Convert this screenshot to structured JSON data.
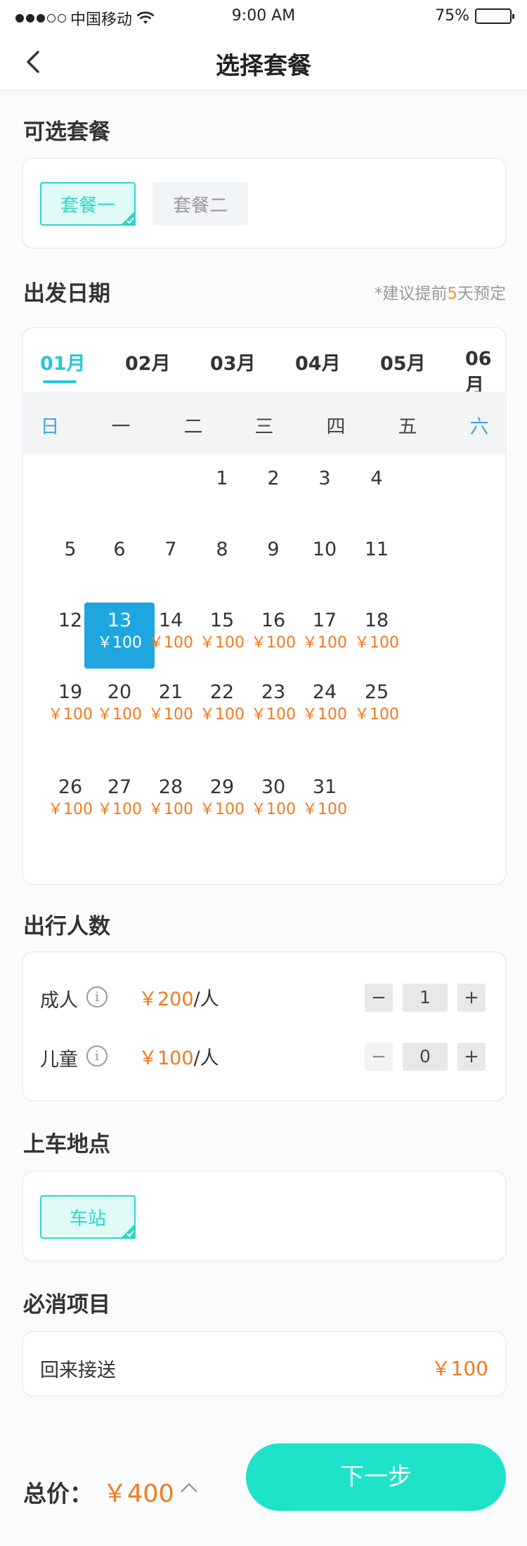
{
  "status_bar": {
    "carrier": "中国移动",
    "time": "9:00 AM",
    "battery": "75%",
    "battery_level": 0.75
  },
  "nav": {
    "title": "选择套餐"
  },
  "packages": {
    "title": "可选套餐",
    "items": [
      {
        "label": "套餐一",
        "selected": true
      },
      {
        "label": "套餐二",
        "selected": false
      }
    ]
  },
  "date": {
    "title": "出发日期",
    "hint_prefix": "*建议提前",
    "hint_days": "5",
    "hint_suffix": "天预定",
    "months": [
      "01月",
      "02月",
      "03月",
      "04月",
      "05月",
      "06月"
    ],
    "active_month": 0,
    "weekdays": [
      "日",
      "一",
      "二",
      "三",
      "四",
      "五",
      "六"
    ],
    "first_weekday": 3,
    "days_in_month": 31,
    "priced_from": 13,
    "selected_day": 13,
    "price": "￥100"
  },
  "travelers": {
    "title": "出行人数",
    "rows": [
      {
        "label": "成人",
        "price": "￥200",
        "unit": "/人",
        "count": "1",
        "minus": "−",
        "plus": "+"
      },
      {
        "label": "儿童",
        "price": "￥100",
        "unit": "/人",
        "count": "0",
        "minus": "−",
        "plus": "+"
      }
    ],
    "info_glyph": "i"
  },
  "pickup": {
    "title": "上车地点",
    "items": [
      {
        "label": "车站",
        "selected": true
      }
    ]
  },
  "required": {
    "title": "必消项目",
    "items": [
      {
        "label": "回来接送",
        "price": "￥100"
      }
    ]
  },
  "footer": {
    "total_label": "总价：",
    "total": "￥400",
    "next_label": "下一步"
  },
  "colors": {
    "accent": "#2ad8c8",
    "price": "#f07a1f",
    "selected_day": "#1fa6e0"
  }
}
